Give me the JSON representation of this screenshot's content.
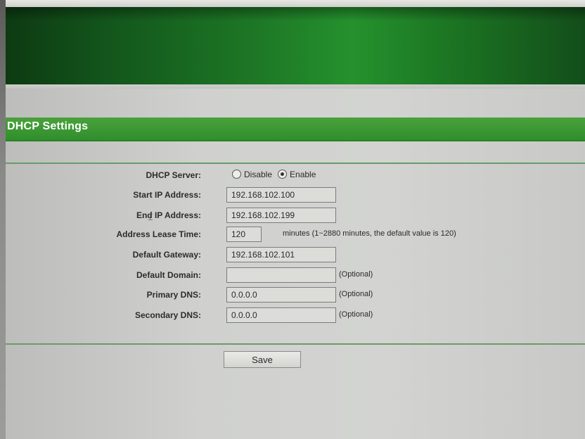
{
  "section": {
    "title": "DHCP Settings"
  },
  "form": {
    "dhcp_server": {
      "label": "DHCP Server:",
      "options": [
        "Disable",
        "Enable"
      ],
      "selected": "Enable"
    },
    "start_ip": {
      "label": "Start IP Address:",
      "value": "192.168.102.100"
    },
    "end_ip": {
      "label": "End IP Address:",
      "value": "192.168.102.199"
    },
    "lease_time": {
      "label": "Address Lease Time:",
      "value": "120",
      "note": "minutes (1~2880 minutes, the default value is 120)"
    },
    "default_gateway": {
      "label": "Default Gateway:",
      "value": "192.168.102.101"
    },
    "default_domain": {
      "label": "Default Domain:",
      "value": "",
      "note": "(Optional)"
    },
    "primary_dns": {
      "label": "Primary DNS:",
      "value": "0.0.0.0",
      "note": "(Optional)"
    },
    "secondary_dns": {
      "label": "Secondary DNS:",
      "value": "0.0.0.0",
      "note": "(Optional)"
    }
  },
  "actions": {
    "save_label": "Save"
  },
  "colors": {
    "banner_green": "#1e7a26",
    "section_green": "#3a9a34",
    "divider": "#6b9a6a"
  },
  "icons": {
    "mouse_cursor": "text-cursor-icon"
  }
}
